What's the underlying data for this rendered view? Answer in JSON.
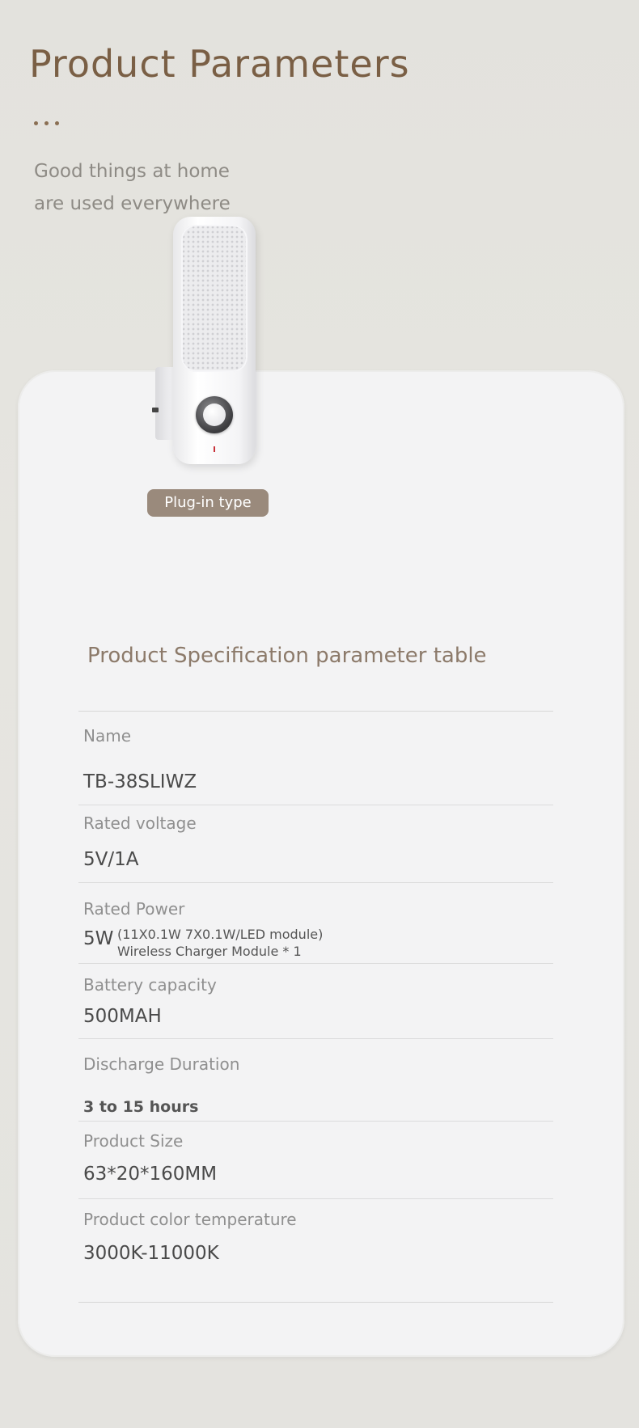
{
  "header": {
    "title": "Product Parameters",
    "slogan_line1": "Good things at home",
    "slogan_line2": "are used everywhere"
  },
  "product": {
    "type_badge": "Plug-in type"
  },
  "spec_table": {
    "title": "Product Specification parameter table",
    "rows": [
      {
        "label": "Name",
        "value": "TB-38SLIWZ"
      },
      {
        "label": "Rated voltage",
        "value": "5V/1A"
      },
      {
        "label": "Rated Power",
        "value": "5W",
        "note_line1": "(11X0.1W 7X0.1W/LED module)",
        "note_line2": "Wireless Charger Module * 1"
      },
      {
        "label": "Battery capacity",
        "value": "500MAH"
      },
      {
        "label": "Discharge Duration",
        "value": "3 to 15 hours"
      },
      {
        "label": "Product Size",
        "value": "63*20*160MM"
      },
      {
        "label": "Product color temperature",
        "value": "3000K-11000K"
      }
    ]
  },
  "colors": {
    "title": "#7a5f45",
    "badge": "#9a8a7c",
    "card": "#f3f3f4",
    "background": "#e3e2dd"
  }
}
